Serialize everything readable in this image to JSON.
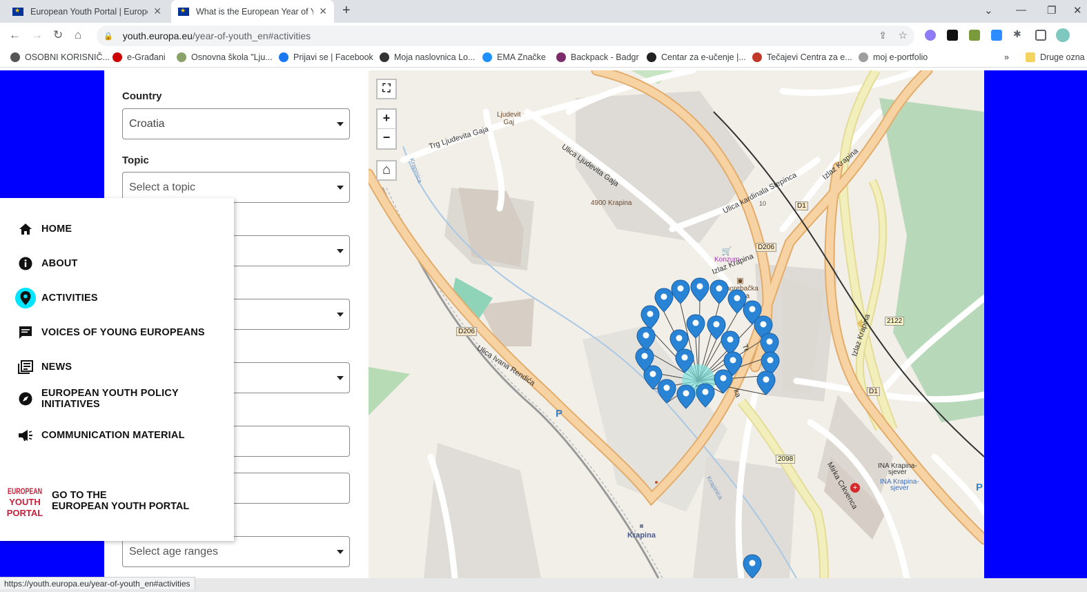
{
  "browser": {
    "tabs": [
      {
        "title": "European Youth Portal | European",
        "close": "✕"
      },
      {
        "title": "What is the European Year of Youth",
        "close": "✕"
      }
    ],
    "new_tab": "+",
    "window_controls": {
      "dropdown": "⌄",
      "minimize": "—",
      "restore": "❐",
      "close": "✕"
    },
    "url_host": "youth.europa.eu",
    "url_path": "/year-of-youth_en#activities",
    "bookmarks": [
      {
        "label": "OSOBNI KORISNIČ...",
        "color": "#555555"
      },
      {
        "label": "e-Građani",
        "color": "#cc0000"
      },
      {
        "label": "Osnovna škola \"Lju...",
        "color": "#8aa36b"
      },
      {
        "label": "Prijavi se | Facebook",
        "color": "#1877f2"
      },
      {
        "label": "Moja naslovnica Lo...",
        "color": "#333333"
      },
      {
        "label": "EMA Značke",
        "color": "#1e90ff"
      },
      {
        "label": "Backpack - Badgr",
        "color": "#7b2d6b"
      },
      {
        "label": "Centar za e-učenje |...",
        "color": "#222222"
      },
      {
        "label": "Tečajevi Centra za e...",
        "color": "#c0392b"
      },
      {
        "label": "moj e-portfolio",
        "color": "#9e9e9e"
      }
    ],
    "bookmarks_more": "»",
    "other_bookmarks": "Druge ozna",
    "status_url": "https://youth.europa.eu/year-of-youth_en#activities"
  },
  "filters": {
    "country_label": "Country",
    "country_value": "Croatia",
    "topic_label": "Topic",
    "topic_placeholder": "Select a topic",
    "age_placeholder": "Select age ranges"
  },
  "menu": {
    "items": [
      {
        "label": "HOME",
        "icon": "home-icon"
      },
      {
        "label": "ABOUT",
        "icon": "info-icon"
      },
      {
        "label": "ACTIVITIES",
        "icon": "location-pin-icon",
        "active": true
      },
      {
        "label": "VOICES OF YOUNG EUROPEANS",
        "icon": "chat-icon"
      },
      {
        "label": "NEWS",
        "icon": "news-icon"
      },
      {
        "label": "EUROPEAN YOUTH POLICY",
        "label2": "INITIATIVES",
        "icon": "compass-icon"
      },
      {
        "label": "COMMUNICATION MATERIAL",
        "icon": "megaphone-icon"
      }
    ],
    "portal_line1": "GO TO THE",
    "portal_line2": "EUROPEAN YOUTH PORTAL",
    "portal_logo": [
      "EUROPEAN",
      "YOUTH",
      "PORTAL"
    ]
  },
  "map": {
    "controls": {
      "fullscreen": "⛶",
      "zoom_in": "+",
      "zoom_out": "−",
      "home": "⌂"
    },
    "cluster_count": "24",
    "labels": {
      "trg": "Trg Ljudevita Gaja",
      "ljudevit": "Ljudevit",
      "gaj": "Gaj",
      "ulica_gaja": "Ulica Ljudevita Gaja",
      "postcode": "4900 Krapina",
      "stepinca": "Ulica kardinala Stepinca",
      "izlaz1": "Izlaz Krapina",
      "izlaz2": "Izlaz Krapina",
      "izlaz3": "Izlaz Krapina",
      "d1a": "D1",
      "d1b": "D1",
      "d206a": "D206",
      "d206b": "D206",
      "konzum": "Konzum",
      "zaba1": "Zagrebačka",
      "zaba2": "banka",
      "r2122": "2122",
      "r2098": "2098",
      "renica": "Ulica Ivana Rendića",
      "krapina": "Krapina",
      "krapinica1": "Krapinica",
      "krapinica2": "Krapinica",
      "ina1": "INA Krapina-",
      "ina2": "sjever",
      "ina3": "INA Krapina-",
      "ina4": "sjever",
      "mirka": "Mirka Crkvenca",
      "parking": "P",
      "parking2": "P",
      "l10": "10",
      "tr": "Tr",
      "ka": "ka"
    }
  },
  "colors": {
    "page_bg": "#0000ff",
    "active_icon": "#00e5ff",
    "marker": "#2a84d6",
    "road_major": "#f6c48a",
    "road_trunk": "#e9e3a0"
  }
}
